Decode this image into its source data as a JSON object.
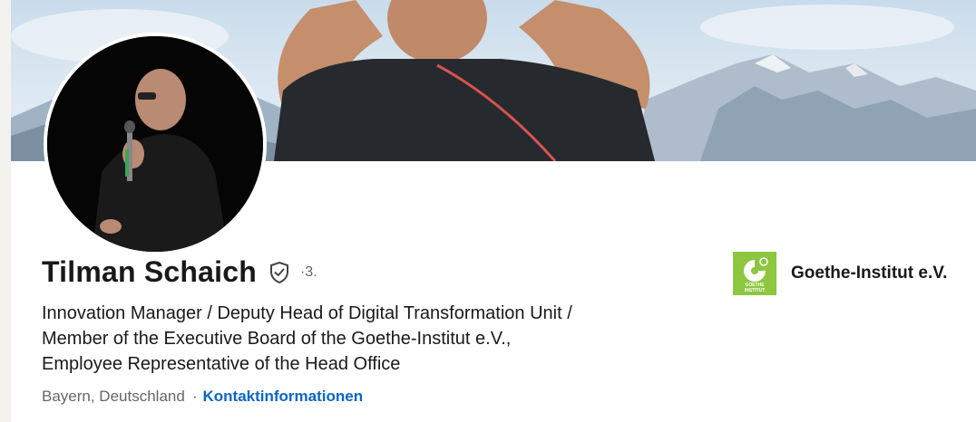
{
  "profile": {
    "name": "Tilman Schaich",
    "degree": "·3.",
    "headline_lines": [
      "Innovation Manager / Deputy Head of Digital Transformation Unit /",
      "Member of the Executive Board of the Goethe-Institut e.V.,",
      "Employee Representative of the Head Office"
    ],
    "location": "Bayern, Deutschland",
    "separator": "·",
    "contact_info": "Kontaktinformationen"
  },
  "company": {
    "name": "Goethe-Institut e.V.",
    "logo_text_top": "GOETHE",
    "logo_text_bottom": "INSTITUT",
    "logo_color": "#8dc63f"
  },
  "icons": {
    "verified": "shield-check-icon"
  },
  "colors": {
    "link": "#0a66c2",
    "text": "#191919",
    "muted": "#666666"
  }
}
